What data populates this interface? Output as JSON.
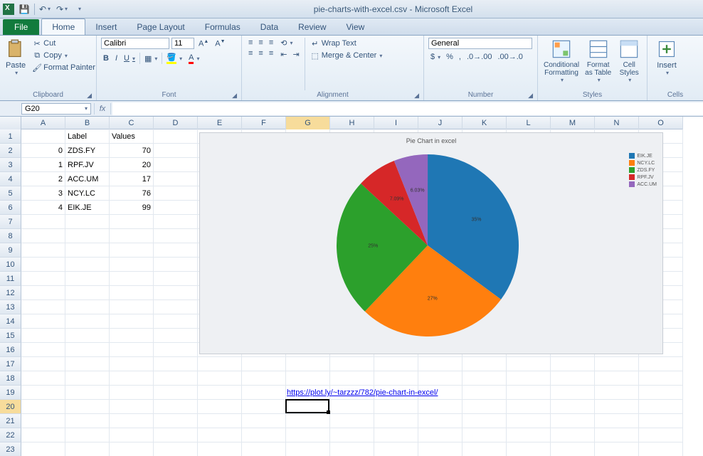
{
  "title": "pie-charts-with-excel.csv - Microsoft Excel",
  "tabs": {
    "file": "File",
    "home": "Home",
    "insert": "Insert",
    "pagelayout": "Page Layout",
    "formulas": "Formulas",
    "data": "Data",
    "review": "Review",
    "view": "View"
  },
  "ribbon": {
    "clipboard": {
      "paste": "Paste",
      "cut": "Cut",
      "copy": "Copy",
      "fmtpainter": "Format Painter",
      "label": "Clipboard"
    },
    "font": {
      "name": "Calibri",
      "size": "11",
      "bold": "B",
      "italic": "I",
      "underline": "U",
      "label": "Font"
    },
    "alignment": {
      "wrap": "Wrap Text",
      "merge": "Merge & Center",
      "label": "Alignment"
    },
    "number": {
      "format": "General",
      "currency": "$",
      "percent": "%",
      "comma": ",",
      "label": "Number"
    },
    "styles": {
      "cond": "Conditional Formatting",
      "table": "Format as Table",
      "cellstyles": "Cell Styles",
      "label": "Styles"
    },
    "cells": {
      "insert": "Insert",
      "label": "Cells"
    }
  },
  "namebox": "G20",
  "headers": {
    "a": "",
    "b": "Label",
    "c": "Values"
  },
  "data_rows": [
    {
      "a": "0",
      "b": "ZDS.FY",
      "c": "70"
    },
    {
      "a": "1",
      "b": "RPF.JV",
      "c": "20"
    },
    {
      "a": "2",
      "b": "ACC.UM",
      "c": "17"
    },
    {
      "a": "3",
      "b": "NCY.LC",
      "c": "76"
    },
    {
      "a": "4",
      "b": "EIK.JE",
      "c": "99"
    }
  ],
  "link": "https://plot.ly/~tarzzz/782/pie-chart-in-excel/",
  "chart_data": {
    "type": "pie",
    "title": "Pie Chart in excel",
    "series": [
      {
        "name": "EIK.JE",
        "value": 99,
        "percent": 35.1,
        "color": "#1f77b4"
      },
      {
        "name": "NCY.LC",
        "value": 76,
        "percent": 27.0,
        "color": "#ff7f0e"
      },
      {
        "name": "ZDS.FY",
        "value": 70,
        "percent": 24.8,
        "color": "#2ca02c"
      },
      {
        "name": "RPF.JV",
        "value": 20,
        "percent": 7.09,
        "color": "#d62728"
      },
      {
        "name": "ACC.UM",
        "value": 17,
        "percent": 6.03,
        "color": "#9467bd"
      }
    ],
    "legend_position": "right"
  },
  "cols": [
    "A",
    "B",
    "C",
    "D",
    "E",
    "F",
    "G",
    "H",
    "I",
    "J",
    "K",
    "L",
    "M",
    "N",
    "O"
  ]
}
